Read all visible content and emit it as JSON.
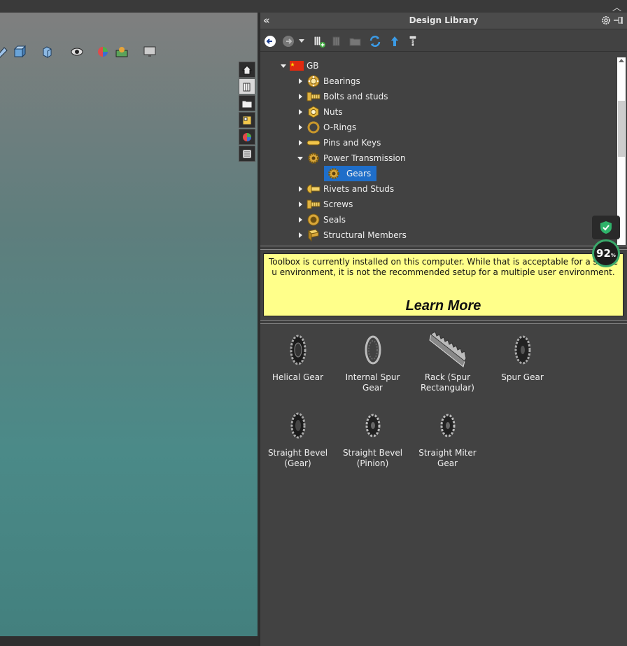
{
  "panel": {
    "title": "Design Library",
    "collapse_glyph": "«"
  },
  "tree": {
    "root_label": "GB",
    "items": [
      {
        "label": "Bearings",
        "icon": "bearing-icon"
      },
      {
        "label": "Bolts and studs",
        "icon": "bolt-icon"
      },
      {
        "label": "Nuts",
        "icon": "nut-icon"
      },
      {
        "label": "O-Rings",
        "icon": "oring-icon"
      },
      {
        "label": "Pins and Keys",
        "icon": "pin-icon"
      },
      {
        "label": "Power Transmission",
        "icon": "gear-icon"
      },
      {
        "label": "Gears",
        "icon": "gear-icon"
      },
      {
        "label": "Rivets and Studs",
        "icon": "rivet-icon"
      },
      {
        "label": "Screws",
        "icon": "screw-icon"
      },
      {
        "label": "Seals",
        "icon": "seal-icon"
      },
      {
        "label": "Structural Members",
        "icon": "beam-icon"
      }
    ]
  },
  "message": {
    "text": "Toolbox is currently installed on this computer. While that is acceptable for a single u environment, it is not the recommended setup for a multiple user environment.",
    "link": "Learn More"
  },
  "items": [
    {
      "label": "Helical Gear"
    },
    {
      "label": "Internal Spur Gear"
    },
    {
      "label": "Rack (Spur Rectangular)"
    },
    {
      "label": "Spur Gear"
    },
    {
      "label": "Straight Bevel (Gear)"
    },
    {
      "label": "Straight Bevel (Pinion)"
    },
    {
      "label": "Straight Miter Gear"
    }
  ],
  "antivirus": {
    "percent": "92",
    "unit": "%",
    "status_color": "#3aa86a"
  },
  "colors": {
    "selection": "#1f6ec9",
    "message_bg": "#ffff8a"
  }
}
